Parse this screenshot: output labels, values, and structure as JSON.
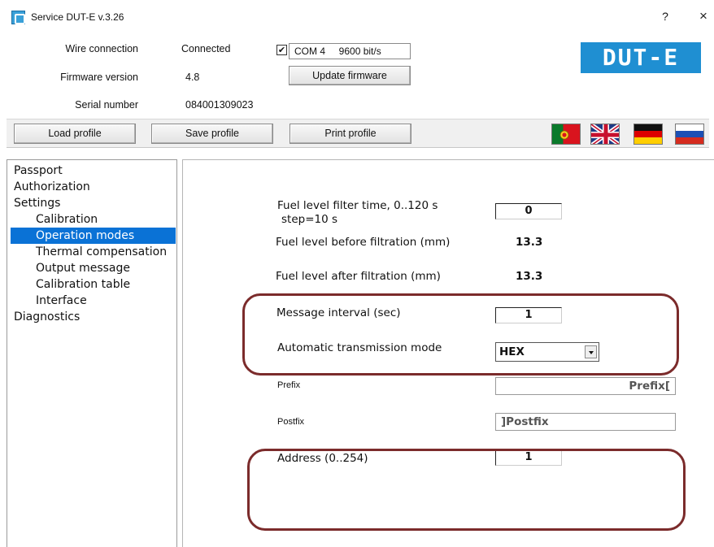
{
  "window": {
    "title": "Service DUT-E  v.3.26",
    "help": "?",
    "close": "×"
  },
  "info": {
    "wire_connection_label": "Wire connection",
    "wire_connection_value": "Connected",
    "firmware_label": "Firmware version",
    "firmware_value": "4.8",
    "serial_label": "Serial number",
    "serial_value": "084001309023",
    "port_checked": true,
    "port_text": "COM 4     9600 bit/s",
    "update_firmware": "Update firmware",
    "logo": "DUT-E"
  },
  "toolbar": {
    "load_profile": "Load profile",
    "save_profile": "Save profile",
    "print_profile": "Print profile",
    "flags": [
      "portugal-flag",
      "uk-flag",
      "germany-flag",
      "russia-flag"
    ]
  },
  "tree": {
    "items": [
      {
        "label": "Passport",
        "level": 0
      },
      {
        "label": "Authorization",
        "level": 0
      },
      {
        "label": "Settings",
        "level": 0
      },
      {
        "label": "Calibration",
        "level": 1
      },
      {
        "label": "Operation modes",
        "level": 1,
        "selected": true
      },
      {
        "label": "Thermal compensation",
        "level": 1
      },
      {
        "label": "Output message",
        "level": 1
      },
      {
        "label": "Calibration table",
        "level": 1
      },
      {
        "label": "Interface",
        "level": 1
      },
      {
        "label": "Diagnostics",
        "level": 0
      }
    ]
  },
  "content": {
    "filter_time_label_1": "Fuel level filter time, 0..120 s",
    "filter_time_label_2": "step=10 s",
    "filter_time_value": "0",
    "before_filtration_label": "Fuel level before filtration (mm)",
    "before_filtration_value": "13.3",
    "after_filtration_label": "Fuel level after filtration (mm)",
    "after_filtration_value": "13.3",
    "message_interval_label": "Message interval (sec)",
    "message_interval_value": "1",
    "transmission_mode_label": "Automatic transmission mode",
    "transmission_mode_value": "HEX",
    "prefix_label": "Prefix",
    "prefix_value": "Prefix[",
    "postfix_label": "Postfix",
    "postfix_value": "]Postfix",
    "address_label": "Address (0..254)",
    "address_value": "1"
  },
  "colors": {
    "accent": "#0a72d6",
    "logo_bg": "#1f8fd2",
    "annotation": "#7b2b2b"
  }
}
